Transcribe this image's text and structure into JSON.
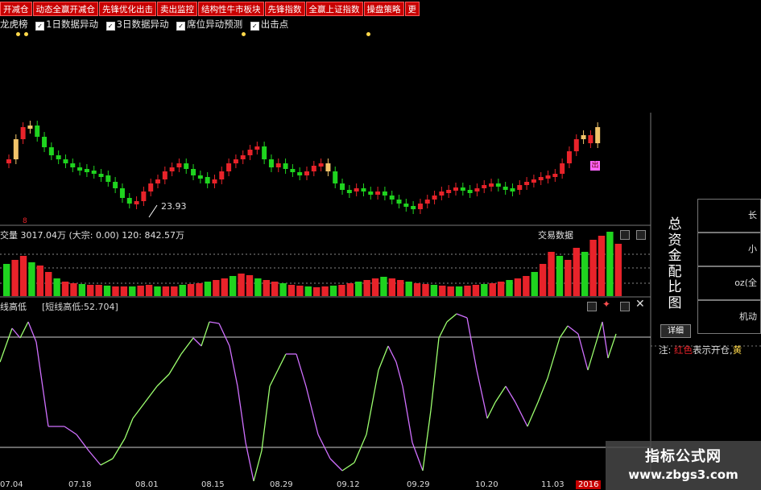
{
  "toolbar": {
    "buttons": [
      "开减仓",
      "动态全赢开减仓",
      "先锋优化出击",
      "卖出监控",
      "结构性牛市板块",
      "先锋指数",
      "全赢上证指数",
      "操盘策略",
      "更"
    ]
  },
  "checks": {
    "first_label": "龙虎榜",
    "items": [
      "1日数据异动",
      "3日数据异动",
      "席位异动预测",
      "出击点"
    ],
    "check_mark": "✓"
  },
  "price_panel": {
    "low_label": "23.93",
    "left_marker": "8",
    "colors": {
      "up": "#e8232a",
      "down": "#1fd41f",
      "signal": "#f2c46a",
      "marker_bg": "#ff66ff"
    },
    "marker_glyph": "出"
  },
  "volume_panel": {
    "info": "交量   3017.04万  (大宗: 0.00)  120: 842.57万",
    "right_title": "交易数据"
  },
  "indicator_panel": {
    "title": "线高低",
    "value_label": "[短线高低:52.704]",
    "colors": {
      "rising": "#9cff6e",
      "falling": "#d070ff",
      "refline": "#cfcfcf"
    }
  },
  "sidebar": {
    "vertical_title": [
      "总",
      "资",
      "金",
      "配",
      "比",
      "图"
    ],
    "boxes": [
      "长",
      "小",
      "oz(全",
      "机动"
    ],
    "detail_button": "详细",
    "note_prefix": "注:",
    "note_red": "红色",
    "note_rest": "表示开仓,",
    "note_yellow": "黄"
  },
  "xaxis": {
    "labels": [
      "07.04",
      "07.18",
      "08.01",
      "08.15",
      "08.29",
      "09.12",
      "09.29",
      "10.20",
      "11.03",
      "2016"
    ]
  },
  "watermark": {
    "line1": "指标公式网",
    "line2": "www.zbgs3.com"
  }
}
